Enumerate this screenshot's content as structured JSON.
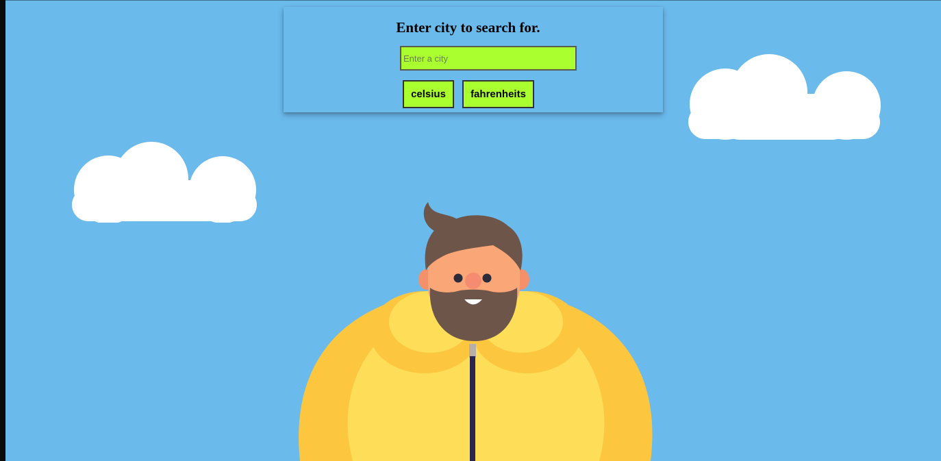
{
  "search": {
    "title": "Enter city to search for.",
    "placeholder": "Enter a city",
    "value": ""
  },
  "buttons": {
    "celsius": "celsius",
    "fahrenheit": "fahrenheits"
  },
  "colors": {
    "background": "#6bbaec",
    "accent": "#aaff2e",
    "cloud": "#ffffff",
    "jacket_light": "#fedd58",
    "jacket_dark": "#fdc63f",
    "hair": "#6d5549",
    "skin": "#fba676"
  },
  "illustration": {
    "icon": "bearded-man-in-yellow-jacket-illustration"
  }
}
